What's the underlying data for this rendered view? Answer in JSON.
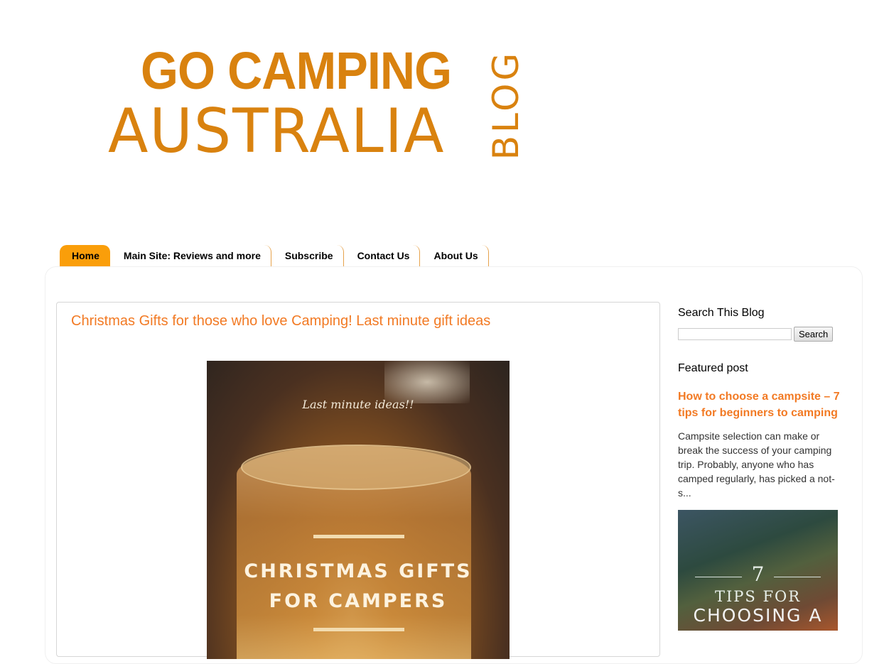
{
  "header": {
    "logo_line1": "GO CAMPING",
    "logo_line2": "AUSTRALIA",
    "logo_blog": "BLOG"
  },
  "nav": {
    "tabs": [
      {
        "label": "Home",
        "active": true
      },
      {
        "label": "Main Site: Reviews and more",
        "active": false
      },
      {
        "label": "Subscribe",
        "active": false
      },
      {
        "label": "Contact Us",
        "active": false
      },
      {
        "label": "About Us",
        "active": false
      }
    ]
  },
  "post": {
    "title": "Christmas Gifts for those who love Camping! Last minute gift ideas",
    "image_kicker": "Last minute ideas!!",
    "image_headline_1": "CHRISTMAS GIFTS",
    "image_headline_2": "FOR CAMPERS"
  },
  "sidebar": {
    "search_title": "Search This Blog",
    "search_value": "",
    "search_button": "Search",
    "featured_title": "Featured post",
    "featured_link": "How to choose a campsite – 7 tips for beginners to camping",
    "featured_snippet": "Campsite selection can make or break the success of your camping trip. Probably, anyone who has camped regularly, has picked a not-s...",
    "featured_image_num": "7",
    "featured_image_line1": "TIPS FOR",
    "featured_image_line2": "CHOOSING A"
  },
  "colors": {
    "brand_orange": "#d9820f",
    "link_orange": "#f27a24",
    "active_tab": "#fa9e0a"
  }
}
